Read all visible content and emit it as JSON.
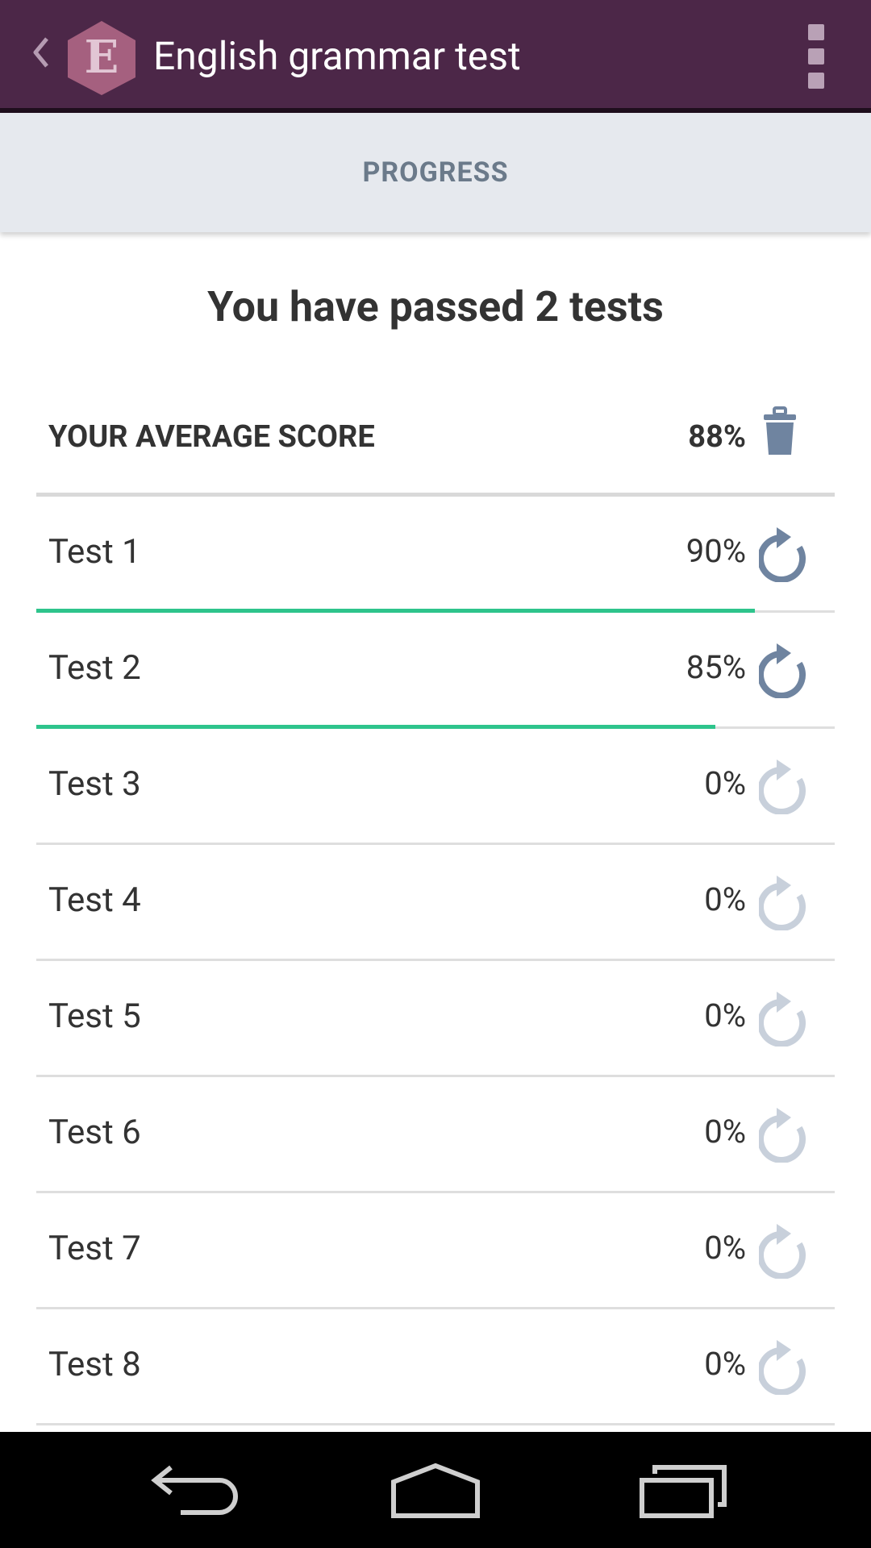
{
  "app_bar": {
    "title": "English grammar test",
    "logo_letter": "E",
    "logo_color": "#a5607f",
    "background": "#4c2748"
  },
  "tabs": {
    "active_label": "PROGRESS"
  },
  "summary": {
    "headline": "You have passed 2 tests",
    "average_label": "YOUR AVERAGE SCORE",
    "average_value": "88%"
  },
  "tests": [
    {
      "name": "Test 1",
      "score": "90%",
      "progress": 0.9,
      "completed": true
    },
    {
      "name": "Test 2",
      "score": "85%",
      "progress": 0.85,
      "completed": true
    },
    {
      "name": "Test 3",
      "score": "0%",
      "progress": 0,
      "completed": false
    },
    {
      "name": "Test 4",
      "score": "0%",
      "progress": 0,
      "completed": false
    },
    {
      "name": "Test 5",
      "score": "0%",
      "progress": 0,
      "completed": false
    },
    {
      "name": "Test 6",
      "score": "0%",
      "progress": 0,
      "completed": false
    },
    {
      "name": "Test 7",
      "score": "0%",
      "progress": 0,
      "completed": false
    },
    {
      "name": "Test 8",
      "score": "0%",
      "progress": 0,
      "completed": false
    }
  ],
  "icons": {
    "back": "chevron-left-icon",
    "logo": "app-logo-hexagon-icon",
    "menu": "overflow-menu-icon",
    "delete": "trash-icon",
    "retry": "replay-icon",
    "nav_back": "back-arrow-icon",
    "nav_home": "home-icon",
    "nav_recents": "recent-apps-icon"
  },
  "colors": {
    "progress": "#2ec48c",
    "icon_active": "#6f84a0",
    "icon_inactive": "#c8d0db"
  }
}
